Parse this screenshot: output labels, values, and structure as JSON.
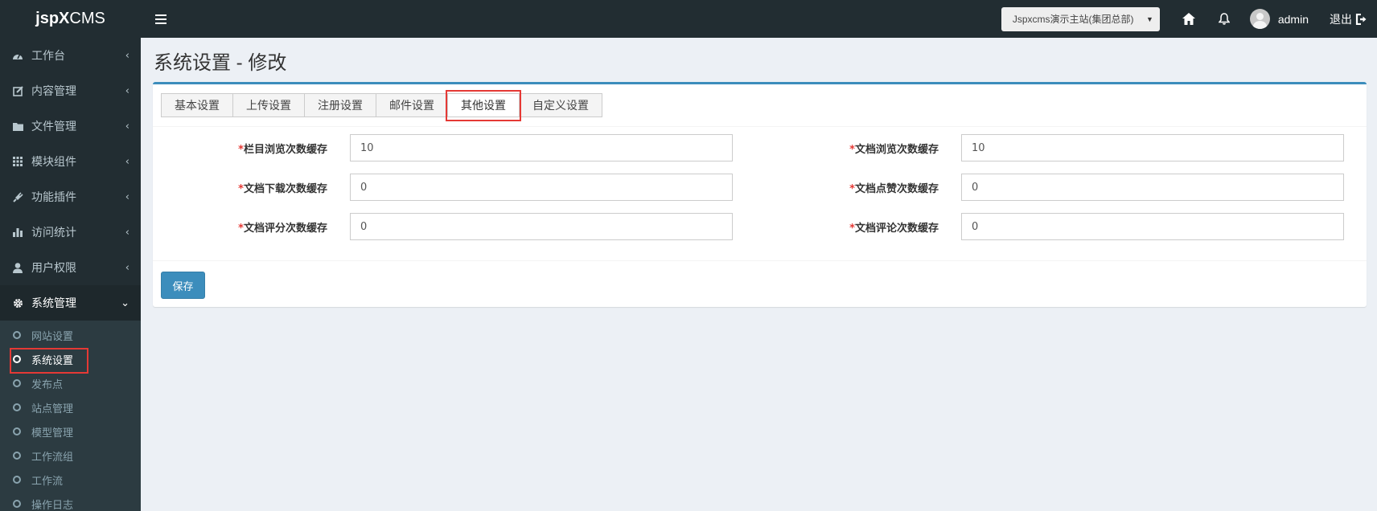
{
  "app": {
    "logo_bold": "jsp",
    "logo_x": "X",
    "logo_rest": "CMS"
  },
  "header": {
    "site_select": "Jspxcms演示主站(集团总部)",
    "username": "admin",
    "logout_label": "退出"
  },
  "sidebar": {
    "items": [
      {
        "label": "工作台",
        "icon": "dashboard-icon"
      },
      {
        "label": "内容管理",
        "icon": "edit-icon"
      },
      {
        "label": "文件管理",
        "icon": "folder-icon"
      },
      {
        "label": "模块组件",
        "icon": "grid-icon"
      },
      {
        "label": "功能插件",
        "icon": "plug-icon"
      },
      {
        "label": "访问统计",
        "icon": "bar-chart-icon"
      },
      {
        "label": "用户权限",
        "icon": "user-icon"
      },
      {
        "label": "系统管理",
        "icon": "gear-icon"
      }
    ],
    "submenu": [
      {
        "label": "网站设置"
      },
      {
        "label": "系统设置"
      },
      {
        "label": "发布点"
      },
      {
        "label": "站点管理"
      },
      {
        "label": "模型管理"
      },
      {
        "label": "工作流组"
      },
      {
        "label": "工作流"
      },
      {
        "label": "操作日志"
      }
    ]
  },
  "page": {
    "title": "系统设置 - 修改"
  },
  "tabs": [
    {
      "label": "基本设置"
    },
    {
      "label": "上传设置"
    },
    {
      "label": "注册设置"
    },
    {
      "label": "邮件设置"
    },
    {
      "label": "其他设置"
    },
    {
      "label": "自定义设置"
    }
  ],
  "form": {
    "required_mark": "*",
    "fields": [
      {
        "label": "栏目浏览次数缓存",
        "value": "10"
      },
      {
        "label": "文档浏览次数缓存",
        "value": "10"
      },
      {
        "label": "文档下载次数缓存",
        "value": "0"
      },
      {
        "label": "文档点赞次数缓存",
        "value": "0"
      },
      {
        "label": "文档评分次数缓存",
        "value": "0"
      },
      {
        "label": "文档评论次数缓存",
        "value": "0"
      }
    ],
    "save_label": "保存"
  }
}
